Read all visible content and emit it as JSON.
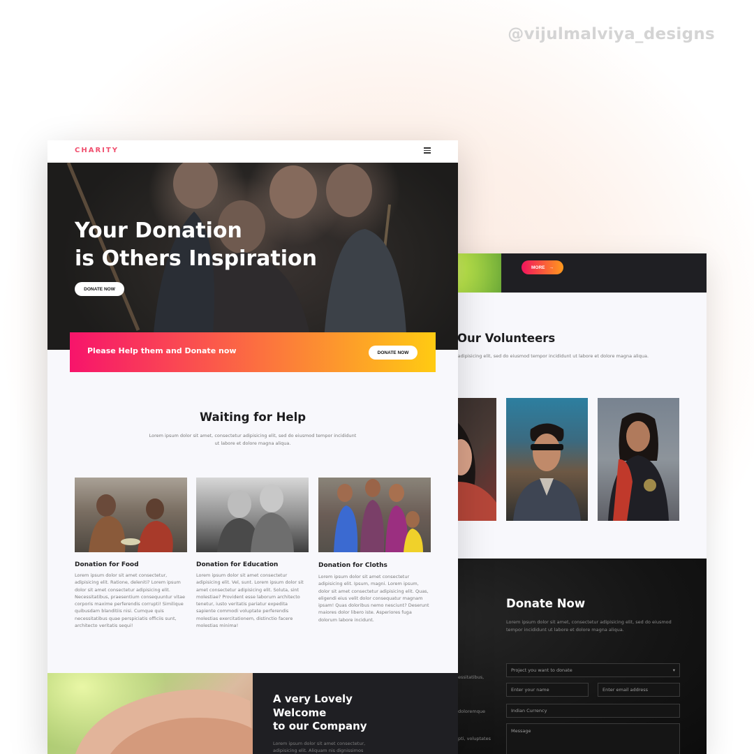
{
  "watermark": "@vijulmalviya_designs",
  "front": {
    "logo": "CHARITY",
    "hero": {
      "title_line1": "Your Donation",
      "title_line2": "is Others Inspiration",
      "button": "DONATE NOW"
    },
    "help_strip": {
      "text": "Please Help them and Donate now",
      "button": "DONATE NOW"
    },
    "waiting": {
      "title": "Waiting for Help",
      "desc": "Lorem ipsum dolor sit amet, consectetur adipisicing elit, sed do eiusmod tempor incididunt ut labore et dolore magna aliqua."
    },
    "cards": [
      {
        "title": "Donation for Food",
        "desc": "Lorem ipsum dolor sit amet consectetur, adipisicing elit. Ratione, deleniti? Lorem ipsum dolor sit amet consectetur adipisicing elit. Necessitatibus, praesentium consequuntur vitae corporis maxime perferendis corrupti! Similique quibusdam blanditiis nisi. Cumque quis necessitatibus quae perspiciatis officiis sunt, architecto veritatis sequi!"
      },
      {
        "title": "Donation for Education",
        "desc": "Lorem ipsum dolor sit amet consectetur adipisicing elit. Vel, sunt. Lorem ipsum dolor sit amet consectetur adipisicing elit. Soluta, sint molestiae? Provident esse laborum architecto tenetur, iusto veritatis pariatur expedita sapiente commodi voluptate perferendis molestias exercitationem, distinctio facere molestias minima!"
      },
      {
        "title": "Donation for Cloths",
        "desc": "Lorem ipsum dolor sit amet consectetur adipisicing elit. Ipsum, magni. Lorem ipsum, dolor sit amet consectetur adipisicing elit. Quas, eligendi eius velit dolor consequatur magnam ipsam! Quas doloribus nemo nesciunt? Deserunt maiores dolor libero iste. Asperiores fuga dolorum labore incidunt."
      }
    ],
    "welcome": {
      "line1": "A very Lovely",
      "line2": "Welcome",
      "line3": "to our Company",
      "desc": "Lorem ipsum dolor sit amet consectetur, adipisicing elit. Aliquam nis dignissimos"
    }
  },
  "back": {
    "more_button": "MORE",
    "volunteers": {
      "title": "Our Volunteers",
      "desc": ", consectetur adipisicing elit, sed do eiusmod tempor incididunt ut labore et dolore magna aliqua."
    },
    "donate": {
      "title": "Donate Now",
      "desc": "Lorem ipsum dolor sit amet, consectetur adipisicing elit, sed do eiusmod tempor incididunt ut labore et dolore magna aliqua.",
      "side_text": [
        "essitatibus,",
        "doloremque",
        "pti, voluptates"
      ],
      "project_select": "Project you want to donate",
      "name_placeholder": "Enter your name",
      "email_placeholder": "Enter email address",
      "currency_placeholder": "Indian Currency",
      "message_placeholder": "Message"
    }
  }
}
